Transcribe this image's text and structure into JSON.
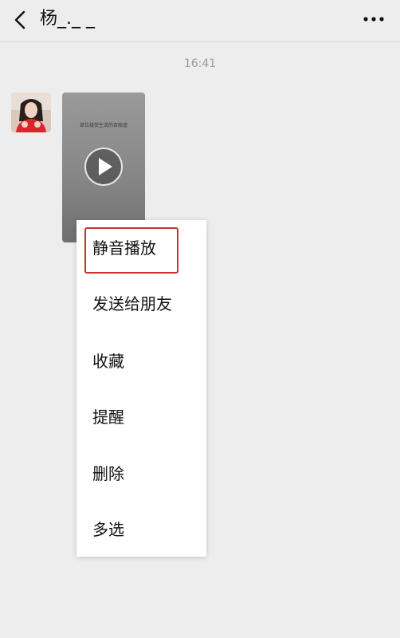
{
  "header": {
    "title": "杨_._ _",
    "back_icon": "chevron-left-icon",
    "more_icon": "ellipsis-icon"
  },
  "chat": {
    "timestamp": "16:41",
    "video_message": {
      "caption": "单位接受生活的百般虐"
    }
  },
  "context_menu": {
    "items": [
      {
        "label": "静音播放"
      },
      {
        "label": "发送给朋友"
      },
      {
        "label": "收藏"
      },
      {
        "label": "提醒"
      },
      {
        "label": "删除"
      },
      {
        "label": "多选"
      }
    ]
  },
  "colors": {
    "background": "#ededed",
    "menu_bg": "#ffffff",
    "highlight": "#c8322a",
    "timestamp_text": "#9a9a9a"
  }
}
